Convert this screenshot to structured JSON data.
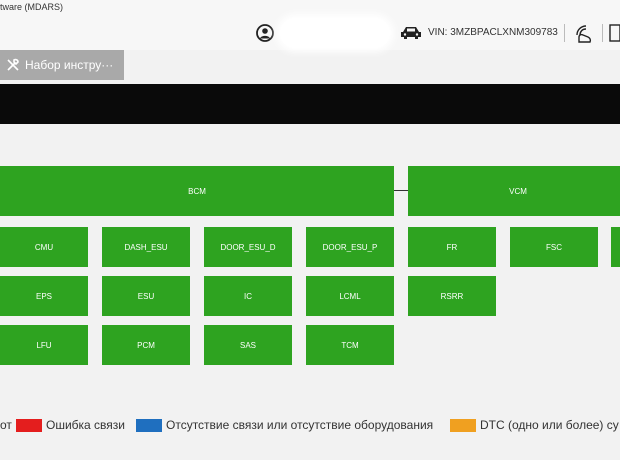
{
  "window": {
    "title": "tware (MDARS)"
  },
  "header": {
    "vin_text": "VIN: 3MZBPACLXNM309783"
  },
  "toolbar": {
    "toolkit_label": "Набор инстру···"
  },
  "modules": {
    "bcm": "BCM",
    "vcm": "VCM",
    "cmu": "CMU",
    "dash_esu": "DASH_ESU",
    "door_esu_d": "DOOR_ESU_D",
    "door_esu_p": "DOOR_ESU_P",
    "fr": "FR",
    "fsc": "FSC",
    "eps": "EPS",
    "esu": "ESU",
    "ic": "IC",
    "lcml": "LCML",
    "rsrr": "RSRR",
    "lfu": "LFU",
    "pcm": "PCM",
    "sas": "SAS",
    "tcm": "TCM"
  },
  "legend": {
    "item0": {
      "label": "от",
      "color": "#2ea320"
    },
    "item1": {
      "label": "Ошибка связи",
      "color": "#e41e1e"
    },
    "item2": {
      "label": "Отсутствие связи или отсутствие оборудования",
      "color": "#1f6fbf"
    },
    "item3": {
      "label": "DTC (одно или более) су",
      "color": "#f0a020"
    }
  },
  "colors": {
    "module_ok": "#2ea320",
    "toolbar_button": "#a9a9a9",
    "banner": "#0a0a0a"
  }
}
